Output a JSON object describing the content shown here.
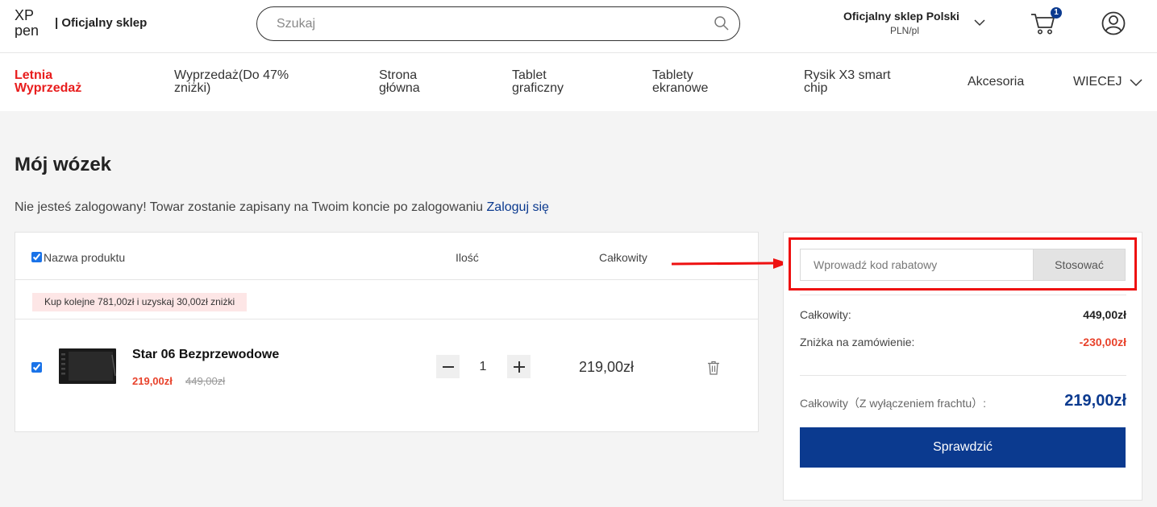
{
  "header": {
    "logo_top": "XP",
    "logo_bottom": "pen",
    "store_label": "| Oficjalny sklep",
    "search_placeholder": "Szukaj",
    "region_name": "Oficjalny sklep Polski",
    "currency_locale": "PLN/pl",
    "cart_count": "1"
  },
  "nav": {
    "items": [
      {
        "label": "Letnia Wyprzedaż"
      },
      {
        "label": "Wyprzedaż(Do 47% zniżki)"
      },
      {
        "label": "Strona główna"
      },
      {
        "label": "Tablet graficzny"
      },
      {
        "label": "Tablety ekranowe"
      },
      {
        "label": "Rysik X3 smart chip"
      },
      {
        "label": "Akcesoria"
      },
      {
        "label": "WIECEJ"
      }
    ]
  },
  "cart": {
    "title": "Mój wózek",
    "notice_text": "Nie jesteś zalogowany! Towar zostanie zapisany na Twoim koncie po zalogowaniu",
    "login_link": "Zaloguj się",
    "columns": {
      "name": "Nazwa produktu",
      "qty": "Ilość",
      "total": "Całkowity"
    },
    "promo_banner": "Kup kolejne 781,00zł i uzyskaj 30,00zł zniżki",
    "items": [
      {
        "name": "Star 06 Bezprzewodowe",
        "price": "219,00zł",
        "old_price": "449,00zł",
        "qty": "1",
        "total": "219,00zł",
        "checked": true
      }
    ]
  },
  "summary": {
    "coupon_placeholder": "Wprowadź kod rabatowy",
    "apply_label": "Stosować",
    "subtotal_label": "Całkowity:",
    "subtotal_value": "449,00zł",
    "discount_label": "Zniżka na zamówienie:",
    "discount_value": "-230,00zł",
    "grand_label": "Całkowity（Z wyłączeniem frachtu）:",
    "grand_value": "219,00zł",
    "checkout_label": "Sprawdzić"
  },
  "colors": {
    "brand": "#0b3a8f",
    "promo": "#e81d1d",
    "price_red": "#e8422b",
    "annotation": "#ee1111"
  }
}
